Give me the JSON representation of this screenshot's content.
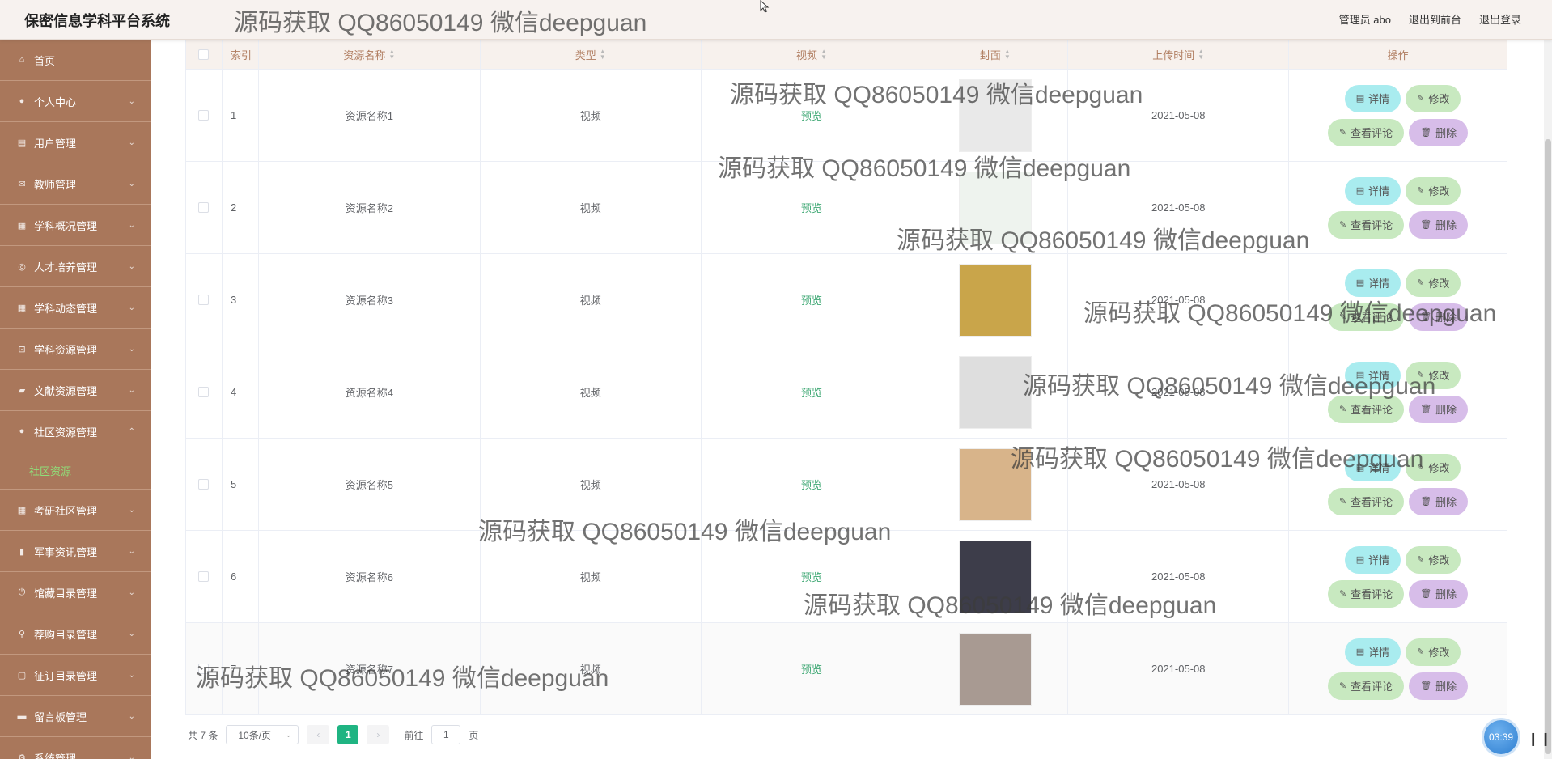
{
  "header": {
    "title": "保密信息学科平台系统",
    "links": [
      "管理员 abo",
      "退出到前台",
      "退出登录"
    ]
  },
  "sidebar": {
    "items": [
      {
        "label": "首页",
        "icon": "home-icon"
      },
      {
        "label": "个人中心",
        "icon": "user-icon"
      },
      {
        "label": "用户管理",
        "icon": "users-icon"
      },
      {
        "label": "教师管理",
        "icon": "mail-icon"
      },
      {
        "label": "学科概况管理",
        "icon": "grid-icon"
      },
      {
        "label": "人才培养管理",
        "icon": "target-icon"
      },
      {
        "label": "学科动态管理",
        "icon": "grid-icon"
      },
      {
        "label": "学科资源管理",
        "icon": "crop-icon"
      },
      {
        "label": "文献资源管理",
        "icon": "folder-icon"
      },
      {
        "label": "社区资源管理",
        "icon": "user-icon"
      },
      {
        "label": "考研社区管理",
        "icon": "grid-icon"
      },
      {
        "label": "军事资讯管理",
        "icon": "bar-chart-icon"
      },
      {
        "label": "馆藏目录管理",
        "icon": "power-icon"
      },
      {
        "label": "荐购目录管理",
        "icon": "pin-icon"
      },
      {
        "label": "征订目录管理",
        "icon": "lock-icon"
      },
      {
        "label": "留言板管理",
        "icon": "briefcase-icon"
      },
      {
        "label": "系统管理",
        "icon": "gear-icon"
      }
    ],
    "sub_active": "社区资源"
  },
  "table": {
    "headers": [
      "索引",
      "资源名称",
      "类型",
      "视频",
      "封面",
      "上传时间",
      "操作"
    ],
    "rows": [
      {
        "index": "1",
        "name": "资源名称1",
        "type": "视频",
        "video": "预览",
        "time": "2021-05-08",
        "cover": "#e9e9e9"
      },
      {
        "index": "2",
        "name": "资源名称2",
        "type": "视频",
        "video": "预览",
        "time": "2021-05-08",
        "cover": "#eef3ee"
      },
      {
        "index": "3",
        "name": "资源名称3",
        "type": "视频",
        "video": "预览",
        "time": "2021-05-08",
        "cover": "#c9a54a"
      },
      {
        "index": "4",
        "name": "资源名称4",
        "type": "视频",
        "video": "预览",
        "time": "2021-05-08",
        "cover": "#dedede"
      },
      {
        "index": "5",
        "name": "资源名称5",
        "type": "视频",
        "video": "预览",
        "time": "2021-05-08",
        "cover": "#d8b48a"
      },
      {
        "index": "6",
        "name": "资源名称6",
        "type": "视频",
        "video": "预览",
        "time": "2021-05-08",
        "cover": "#3d3d4a"
      },
      {
        "index": "7",
        "name": "资源名称7",
        "type": "视频",
        "video": "预览",
        "time": "2021-05-08",
        "cover": "#a89a92"
      }
    ],
    "actions": {
      "detail": "详情",
      "edit": "修改",
      "comment": "查看评论",
      "delete": "删除"
    }
  },
  "pager": {
    "total": "共 7 条",
    "page_size": "10条/页",
    "current": "1",
    "goto_prefix": "前往",
    "goto_value": "1",
    "goto_suffix": "页"
  },
  "timer": "03:39",
  "watermark": "源码获取 QQ86050149 微信deepguan",
  "colors": {
    "sidebar": "#a9775b",
    "accent": "#1fb482",
    "header": "#f7f2ef"
  }
}
